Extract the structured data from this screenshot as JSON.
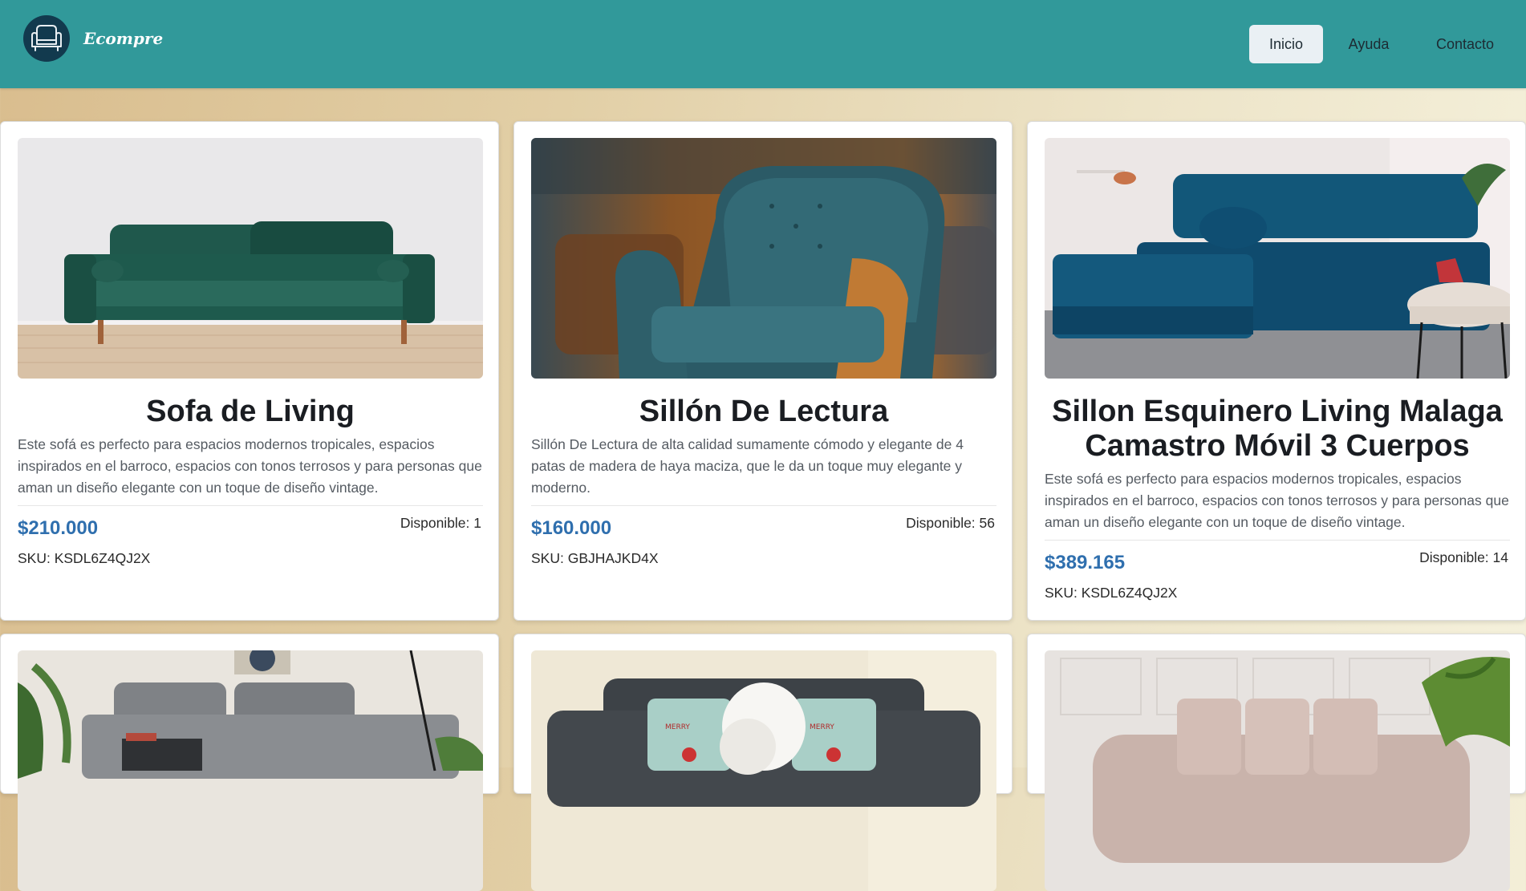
{
  "header": {
    "brand": "Ecompre",
    "logo_icon": "armchair-icon",
    "nav": [
      {
        "label": "Inicio",
        "active": true
      },
      {
        "label": "Ayuda",
        "active": false
      },
      {
        "label": "Contacto",
        "active": false
      }
    ],
    "colors": {
      "navbar": "#31999a",
      "logo_bg": "#123a4e",
      "price": "#2f6fae"
    }
  },
  "products": [
    {
      "title": "Sofa de Living",
      "description": "Este sofá es perfecto para espacios modernos tropicales, espacios inspirados en el barroco, espacios con tonos terrosos y para personas que aman un diseño elegante con un toque de diseño vintage.",
      "price": "$210.000",
      "available": "Disponible: 1",
      "sku": "SKU: KSDL6Z4QJ2X",
      "image": "green-velvet-sofa-image"
    },
    {
      "title": "Sillón De Lectura",
      "description": "Sillón De Lectura de alta calidad sumamente cómodo y elegante de 4 patas de madera de haya maciza, que le da un toque muy elegante y moderno.",
      "price": "$160.000",
      "available": "Disponible: 56",
      "sku": "SKU: GBJHAJKD4X",
      "image": "teal-armchair-image"
    },
    {
      "title": "Sillon Esquinero Living Malaga Camastro Móvil 3 Cuerpos",
      "description": "Este sofá es perfecto para espacios modernos tropicales, espacios inspirados en el barroco, espacios con tonos terrosos y para personas que aman un diseño elegante con un toque de diseño vintage.",
      "price": "$389.165",
      "available": "Disponible: 14",
      "sku": "SKU: KSDL6Z4QJ2X",
      "image": "blue-sectional-sofa-image"
    },
    {
      "image": "grey-sofa-image"
    },
    {
      "image": "dark-grey-sofa-with-christmas-pillows-image"
    },
    {
      "image": "pink-sofa-image"
    }
  ]
}
